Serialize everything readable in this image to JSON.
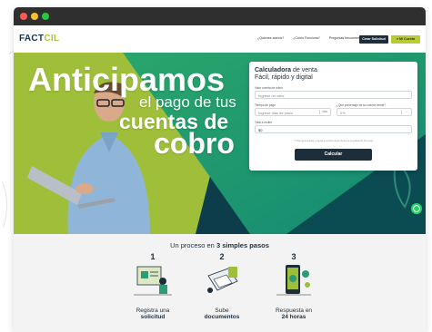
{
  "window": {
    "controls": [
      "close",
      "minimize",
      "maximize"
    ]
  },
  "navbar": {
    "logo_main": "FACT",
    "logo_accent": "CIL",
    "links": [
      "¿Quienes somos?",
      "¿Cómo Funciona?",
      "Preguntas frecuentes"
    ],
    "cta_primary": "Crear Solicitud",
    "cta_secondary": "Mi Cuenta"
  },
  "hero": {
    "line1": "Anticipamos",
    "line2": "el pago de tus",
    "line3": "cuentas de",
    "line4": "cobro"
  },
  "calculator": {
    "title_bold": "Calculadora",
    "title_rest": " de venta",
    "subtitle": "Fácil, rápido y digital",
    "amount_label": "Valor cuenta de cobro",
    "amount_placeholder": "Ingrese un valor",
    "term_label": "Tiempo de pago",
    "term_value": "Ingrese días de plazo",
    "term_unit": "días",
    "percent_label": "¿Qué porcentaje de su cuenta vende?",
    "percent_value": "0%",
    "result_label": "Total a recibir",
    "result_value": "$0",
    "note": "* Cifras aproximadas y sujetas a cambios dependiendo de la evaluación del riesgo",
    "button": "Calcular"
  },
  "process": {
    "title_prefix": "Un proceso en ",
    "title_bold": "3 simples pasos",
    "steps": [
      {
        "number": "1",
        "line1": "Registra una",
        "line2": "solicitud"
      },
      {
        "number": "2",
        "line1": "Sube",
        "line2": "documentos"
      },
      {
        "number": "3",
        "line1": "Respuesta en",
        "line2": "24 horas"
      }
    ]
  },
  "colors": {
    "navy": "#1e2d3a",
    "lime": "#b7cc34",
    "hero_green": "#1a9a6e",
    "hero_dark": "#0c3a48",
    "whatsapp": "#25d366"
  }
}
